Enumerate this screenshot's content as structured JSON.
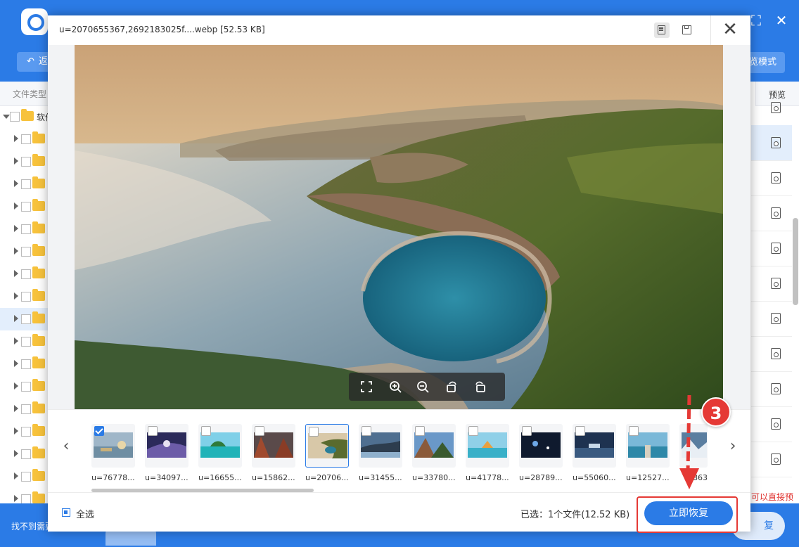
{
  "background_app": {
    "toolbar": {
      "back_label": "返",
      "mode_label": "览模式"
    },
    "sidebar": {
      "header": "文件类型",
      "root_label": "软件",
      "row_count": 18
    },
    "right_column": {
      "header": "预览"
    },
    "hint_text": "可以直接预览",
    "footer": {
      "left_text": "找不到需要",
      "right_button": "复"
    },
    "window_controls": {
      "fullscreen": "⛶",
      "close": "✕"
    }
  },
  "dialog": {
    "title": "u=2070655367,2692183025f....webp [52.53 KB]",
    "close_glyph": "✕",
    "zoom_toolbar": [
      "fullscreen-icon",
      "zoom-in-icon",
      "zoom-out-icon",
      "rotate-left-icon",
      "rotate-right-icon"
    ],
    "nav": {
      "prev": "‹",
      "next": "›"
    },
    "thumbnails": [
      {
        "label": "u=76778...",
        "checked": true
      },
      {
        "label": "u=34097...",
        "checked": false
      },
      {
        "label": "u=16655...",
        "checked": false
      },
      {
        "label": "u=15862...",
        "checked": false
      },
      {
        "label": "u=20706...",
        "checked": false,
        "current": true
      },
      {
        "label": "u=31455...",
        "checked": false
      },
      {
        "label": "u=33780...",
        "checked": false
      },
      {
        "label": "u=41778...",
        "checked": false
      },
      {
        "label": "u=28789...",
        "checked": false
      },
      {
        "label": "u=55060...",
        "checked": false
      },
      {
        "label": "u=12527...",
        "checked": false
      },
      {
        "label": "863",
        "checked": false
      }
    ],
    "footer": {
      "select_all": "全选",
      "selected_info": "已选：1个文件(12.52 KB)",
      "recover_button": "立即恢复"
    }
  },
  "annotation": {
    "step_number": "3",
    "color": "#e53935"
  },
  "colors": {
    "accent": "#2b7be6",
    "folder": "#f7c23c",
    "annotation": "#e53935"
  }
}
